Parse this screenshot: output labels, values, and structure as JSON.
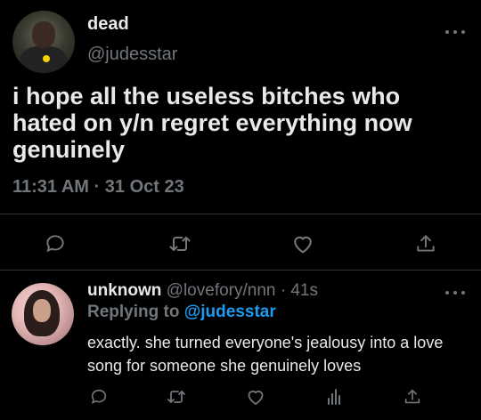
{
  "tweet": {
    "display_name": "dead",
    "handle": "@judesstar",
    "text": "i hope all the useless bitches who hated on y/n regret everything now genuinely",
    "time": "11:31 AM",
    "separator": "·",
    "date": "31 Oct 23"
  },
  "reply": {
    "display_name": "unknown",
    "handle": "@lovefory/nnn",
    "separator": "·",
    "age": "41s",
    "replying_label": "Replying to",
    "replying_to": "@judesstar",
    "text": "exactly. she turned everyone's jealousy into a love song for someone she genuinely loves"
  },
  "icons": {
    "more": "more-icon",
    "reply": "comment-icon",
    "retweet": "retweet-icon",
    "like": "heart-icon",
    "share": "share-icon",
    "analytics": "analytics-icon"
  },
  "colors": {
    "background": "#000000",
    "text": "#e7e9ea",
    "muted": "#71767b",
    "link": "#1d9bf0"
  }
}
